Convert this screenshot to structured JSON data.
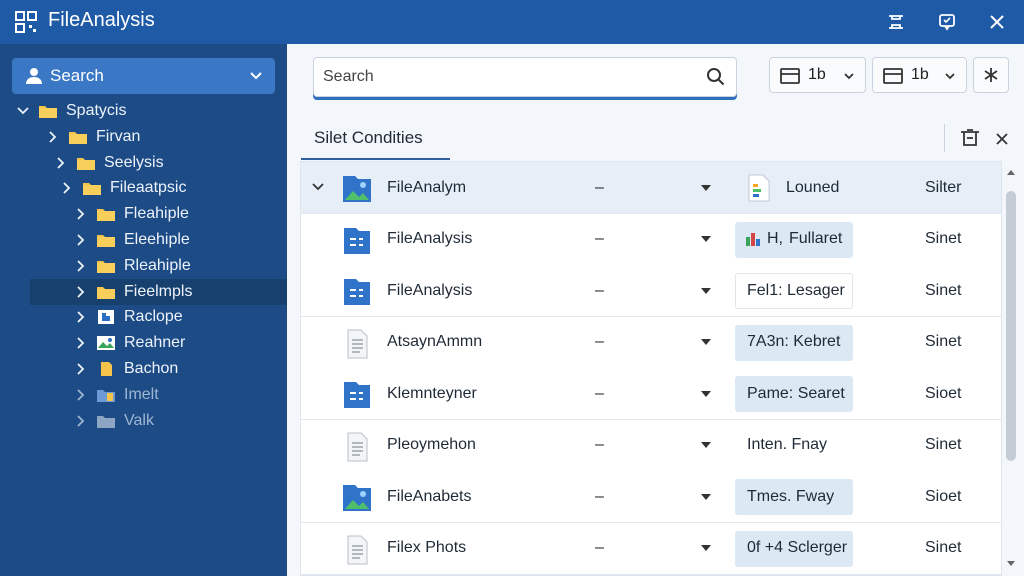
{
  "app": {
    "title": "FileAnalysis"
  },
  "sidebar": {
    "search_label": "Search",
    "tree": [
      {
        "label": "Spatycis",
        "level": 0,
        "expanded": true,
        "icon": "folder-icon"
      },
      {
        "label": "Firvan",
        "level": 1,
        "expanded": false,
        "icon": "folder-icon"
      },
      {
        "label": "Seelysis",
        "level": 2,
        "expanded": false,
        "icon": "folder-icon"
      },
      {
        "label": "Fileaatpsic",
        "level": 3,
        "expanded": false,
        "icon": "folder-icon"
      },
      {
        "label": "Fleahiple",
        "level": 4,
        "expanded": false,
        "icon": "folder-icon"
      },
      {
        "label": "Eleehiple",
        "level": 4,
        "expanded": false,
        "icon": "folder-icon"
      },
      {
        "label": "Rleahiple",
        "level": 4,
        "expanded": false,
        "icon": "folder-icon"
      },
      {
        "label": "Fieelmpls",
        "level": 4,
        "expanded": false,
        "icon": "folder-icon",
        "selected": true
      },
      {
        "label": "Raclope",
        "level": 4,
        "expanded": false,
        "icon": "puzzle-icon"
      },
      {
        "label": "Reahner",
        "level": 4,
        "expanded": false,
        "icon": "image-icon"
      },
      {
        "label": "Bachon",
        "level": 4,
        "expanded": false,
        "icon": "document-icon"
      },
      {
        "label": "Imelt",
        "level": 4,
        "expanded": false,
        "icon": "folder-file-icon",
        "faded": true
      },
      {
        "label": "Valk",
        "level": 4,
        "expanded": false,
        "icon": "folder-sync-icon",
        "faded": true
      }
    ]
  },
  "main": {
    "search_placeholder": "Search",
    "toolbar": {
      "view_value": "1b",
      "sort_value": "1b"
    },
    "section_title": "Silet Condities",
    "rows": [
      {
        "name": "FileAnalym",
        "dash": "–",
        "status": "Louned",
        "type": "Silter",
        "icon": "image-file-icon",
        "status_icon": "document-colored-icon",
        "expanded": true,
        "pill": "none"
      },
      {
        "name": "FileAnalysis",
        "dash": "–",
        "status": "Fullaret",
        "status_prefix": "H,",
        "type": "Sinet",
        "icon": "blue-document-icon",
        "status_icon": "chart-icon",
        "pill": "filled"
      },
      {
        "name": "FileAnalysis",
        "dash": "–",
        "status": "Fel1: Lesager",
        "type": "Sinet",
        "icon": "blue-document-icon",
        "pill": "plain"
      },
      {
        "name": "AtsaynAmmn",
        "dash": "–",
        "status": "7A3n: Kebret",
        "type": "Sinet",
        "icon": "text-file-icon",
        "pill": "filled"
      },
      {
        "name": "Klemnteyner",
        "dash": "–",
        "status": "Pame: Searet",
        "type": "Sioet",
        "icon": "blue-document-icon",
        "pill": "filled"
      },
      {
        "name": "Pleoymehon",
        "dash": "–",
        "status": "Inten. Fnay",
        "type": "Sinet",
        "icon": "text-file-icon",
        "pill": "none"
      },
      {
        "name": "FileAnabets",
        "dash": "–",
        "status": "Tmes. Fway",
        "type": "Sioet",
        "icon": "image-file-icon",
        "pill": "filled"
      },
      {
        "name": "Filex Phots",
        "dash": "–",
        "status": "0f +4 Sclerger",
        "type": "Sinet",
        "icon": "text-file-icon",
        "pill": "filled"
      }
    ]
  }
}
